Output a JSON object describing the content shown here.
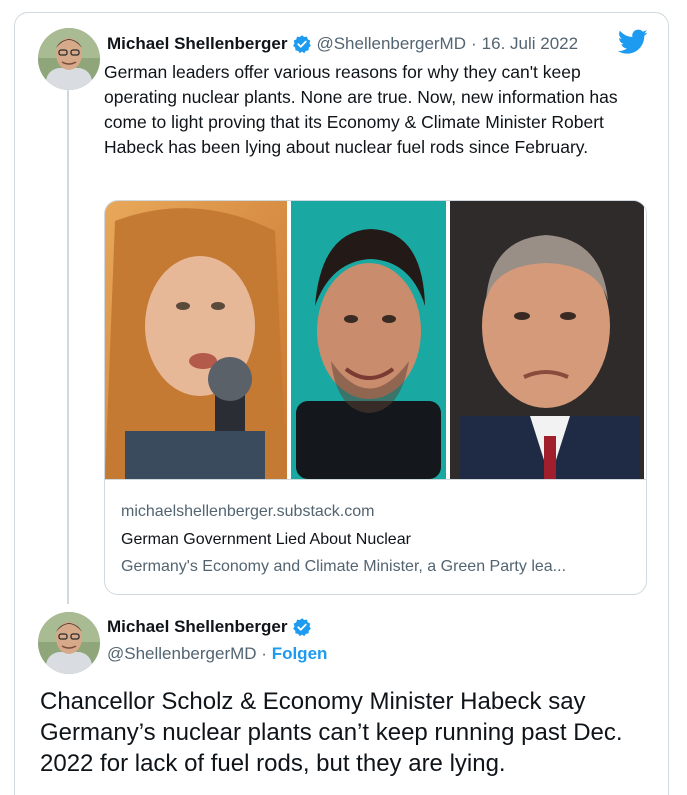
{
  "tweet1": {
    "author_name": "Michael Shellenberger",
    "handle": "@ShellenbergerMD",
    "separator": "·",
    "date": "16. Juli 2022",
    "text": "German leaders offer various reasons for why they can't keep operating nuclear plants. None are true. Now, new information has come to light proving that its Economy & Climate Minister Robert Habeck has been lying about nuclear fuel rods since February.",
    "link_card": {
      "domain": "michaelshellenberger.substack.com",
      "title": "German Government Lied About Nuclear",
      "description": "Germany's Economy and Climate Minister, a Green Party lea..."
    }
  },
  "tweet2": {
    "author_name": "Michael Shellenberger",
    "handle": "@ShellenbergerMD",
    "separator": "·",
    "follow_label": "Folgen",
    "text": "Chancellor Scholz & Economy Minister Habeck say Germany’s nuclear plants can’t keep running past Dec. 2022 for lack of fuel rods, but they are lying."
  },
  "icons": {
    "verified": "verified-badge-icon",
    "brand": "twitter-bird-icon"
  },
  "colors": {
    "accent": "#1d9bf0",
    "text_primary": "#0f1419",
    "text_secondary": "#536471",
    "border": "#cfd9de"
  }
}
